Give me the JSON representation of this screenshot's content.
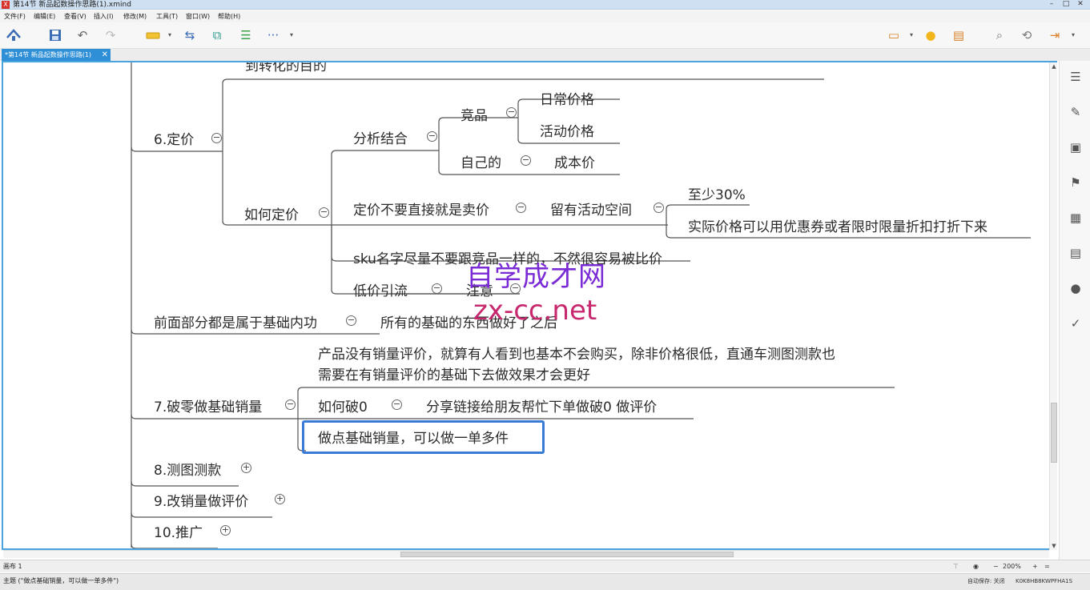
{
  "window": {
    "title": "第14节 新品起数操作思路(1).xmind",
    "app_icon": "X"
  },
  "menu": [
    "文件(F)",
    "编辑(E)",
    "查看(V)",
    "插入(I)",
    "修改(M)",
    "工具(T)",
    "窗口(W)",
    "帮助(H)"
  ],
  "toolbar": {
    "home_icon": "home-icon",
    "save_icon": "save-icon",
    "undo_icon": "undo-icon",
    "redo_icon": "redo-icon",
    "topic_icon": "topic-icon",
    "relationship_icon": "relationship-icon",
    "boundary_icon": "boundary-icon",
    "summary_icon": "summary-icon",
    "more_label": "···",
    "presentation_icon": "presentation-icon",
    "idea_icon": "lightbulb-icon",
    "gantt_icon": "gantt-icon",
    "search_icon": "search-icon",
    "share_icon": "share-icon",
    "export_icon": "export-icon"
  },
  "tab": {
    "label": "*第14节 新品起数操作思路(1)",
    "close": "✕"
  },
  "mindmap": {
    "nodes": {
      "top_partial": "到转化的目的",
      "pricing": "6.定价",
      "analysis": "分析结合",
      "competitor": "竞品",
      "daily_price": "日常价格",
      "promo_price": "活动价格",
      "own": "自己的",
      "cost_price": "成本价",
      "how_price": "如何定价",
      "not_direct": "定价不要直接就是卖价",
      "leave_room": "留有活动空间",
      "at_least": "至少30%",
      "actual_price": "实际价格可以用优惠券或者限时限量折扣打折下来",
      "sku_name": "sku名字尽量不要跟竞品一样的，不然很容易被比价",
      "low_price": "低价引流",
      "note": "注意",
      "basics": "前面部分都是属于基础内功",
      "after_basics": "所有的基础的东西做好了之后",
      "break_zero": "7.破零做基础销量",
      "no_sales_1": "产品没有销量评价，就算有人看到也基本不会购买，除非价格很低，直通车测图测款也",
      "no_sales_2": "需要在有销量评价的基础下去做效果才会更好",
      "how_break": "如何破0",
      "share_link": "分享链接给朋友帮忙下单做破0 做评价",
      "do_sales": "做点基础销量，可以做一单多件",
      "test_image": "8.测图测款",
      "modify_sales": "9.改销量做评价",
      "promotion": "10.推广"
    },
    "collapse_symbol": "−",
    "expand_symbol": "+",
    "line_color": "#555555",
    "selection_color": "#3a7bd5"
  },
  "watermark": {
    "line1": "自学成才网",
    "line2": "zx-cc.net"
  },
  "sidebar": [
    "outline-icon",
    "format-brush-icon",
    "image-icon",
    "flag-icon",
    "markers-icon",
    "notes-icon",
    "comments-icon",
    "task-icon"
  ],
  "sheetbar": {
    "sheet": "画布 1",
    "zoom": "200%",
    "minus": "−",
    "plus": "+",
    "fit": "="
  },
  "status": {
    "text": "主题 (\"做点基础销量，可以做一单多件\")",
    "autosave": "自动保存: 关闭",
    "account": "K0K8HB8KWPFHA1S"
  }
}
